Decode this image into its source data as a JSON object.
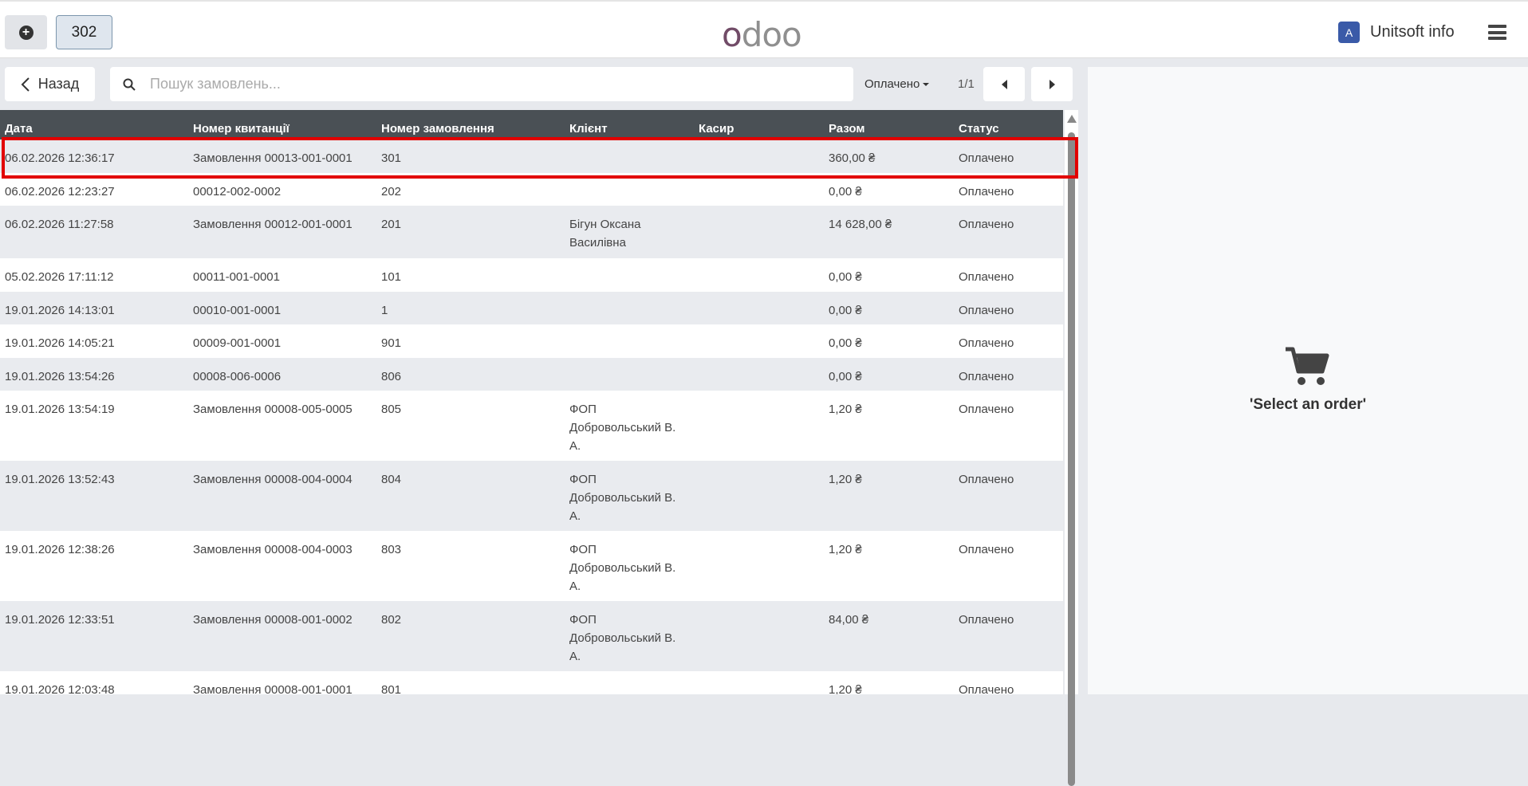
{
  "header": {
    "new_order_icon": "plus-circle-icon",
    "current_order": "302",
    "logo": "odoo",
    "user_initial": "A",
    "user_name": "Unitsoft info",
    "menu_icon": "hamburger-icon"
  },
  "controls": {
    "back_label": "Назад",
    "search_placeholder": "Пошук замовлень...",
    "filter_label": "Оплачено",
    "pager": "1/1"
  },
  "table": {
    "columns": [
      "Дата",
      "Номер квитанції",
      "Номер замовлення",
      "Клієнт",
      "Касир",
      "Разом",
      "Статус"
    ],
    "rows": [
      {
        "date": "06.02.2026 12:36:17",
        "receipt": "Замовлення 00013-001-0001",
        "order": "301",
        "client": "",
        "cashier": "",
        "total": "360,00 ₴",
        "status": "Оплачено"
      },
      {
        "date": "06.02.2026 12:23:27",
        "receipt": "00012-002-0002",
        "order": "202",
        "client": "",
        "cashier": "",
        "total": "0,00 ₴",
        "status": "Оплачено"
      },
      {
        "date": "06.02.2026 11:27:58",
        "receipt": "Замовлення 00012-001-0001",
        "order": "201",
        "client": "Бігун Оксана Василівна",
        "cashier": "",
        "total": "14 628,00 ₴",
        "status": "Оплачено"
      },
      {
        "date": "05.02.2026 17:11:12",
        "receipt": "00011-001-0001",
        "order": "101",
        "client": "",
        "cashier": "",
        "total": "0,00 ₴",
        "status": "Оплачено"
      },
      {
        "date": "19.01.2026 14:13:01",
        "receipt": "00010-001-0001",
        "order": "1",
        "client": "",
        "cashier": "",
        "total": "0,00 ₴",
        "status": "Оплачено"
      },
      {
        "date": "19.01.2026 14:05:21",
        "receipt": "00009-001-0001",
        "order": "901",
        "client": "",
        "cashier": "",
        "total": "0,00 ₴",
        "status": "Оплачено"
      },
      {
        "date": "19.01.2026 13:54:26",
        "receipt": "00008-006-0006",
        "order": "806",
        "client": "",
        "cashier": "",
        "total": "0,00 ₴",
        "status": "Оплачено"
      },
      {
        "date": "19.01.2026 13:54:19",
        "receipt": "Замовлення 00008-005-0005",
        "order": "805",
        "client": "ФОП Добровольський В. А.",
        "cashier": "",
        "total": "1,20 ₴",
        "status": "Оплачено"
      },
      {
        "date": "19.01.2026 13:52:43",
        "receipt": "Замовлення 00008-004-0004",
        "order": "804",
        "client": "ФОП Добровольський В. А.",
        "cashier": "",
        "total": "1,20 ₴",
        "status": "Оплачено"
      },
      {
        "date": "19.01.2026 12:38:26",
        "receipt": "Замовлення 00008-004-0003",
        "order": "803",
        "client": "ФОП Добровольський В. А.",
        "cashier": "",
        "total": "1,20 ₴",
        "status": "Оплачено"
      },
      {
        "date": "19.01.2026 12:33:51",
        "receipt": "Замовлення 00008-001-0002",
        "order": "802",
        "client": "ФОП Добровольський В. А.",
        "cashier": "",
        "total": "84,00 ₴",
        "status": "Оплачено"
      },
      {
        "date": "19.01.2026 12:03:48",
        "receipt": "Замовлення 00008-001-0001",
        "order": "801",
        "client": "",
        "cashier": "",
        "total": "1,20 ₴",
        "status": "Оплачено"
      }
    ]
  },
  "detail": {
    "empty_icon": "cart-icon",
    "empty_text": "'Select an order'"
  }
}
